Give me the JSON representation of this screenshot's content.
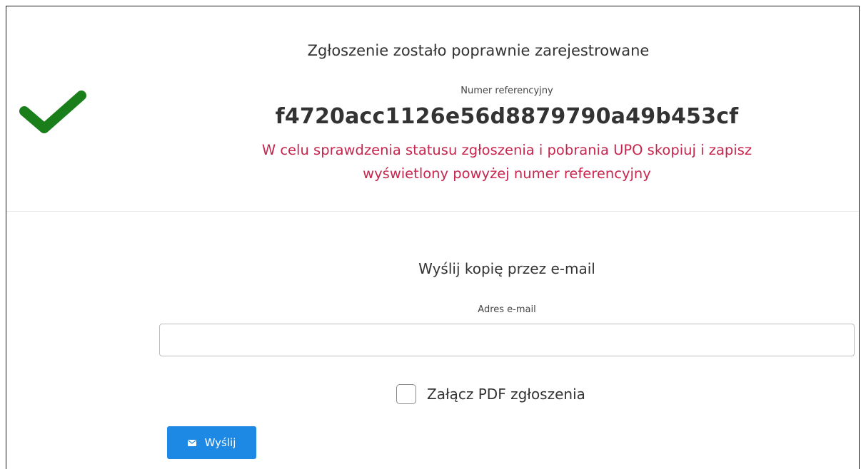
{
  "confirmation": {
    "title": "Zgłoszenie zostało poprawnie zarejestrowane",
    "reference_label": "Numer referencyjny",
    "reference_number": "f4720acc1126e56d8879790a49b453cf",
    "warning_line1": "W celu sprawdzenia statusu zgłoszenia i pobrania UPO skopiuj i zapisz",
    "warning_line2": "wyświetlony powyżej numer referencyjny",
    "icon": "check-icon",
    "icon_color": "#1a7f1a",
    "warning_color": "#c7254e"
  },
  "email_form": {
    "title": "Wyślij kopię przez e-mail",
    "email_label": "Adres e-mail",
    "email_value": "",
    "email_placeholder": "",
    "attach_pdf_label": "Załącz PDF zgłoszenia",
    "attach_pdf_checked": false,
    "send_label": "Wyślij",
    "send_icon": "envelope-icon",
    "button_color": "#1e88e5"
  }
}
